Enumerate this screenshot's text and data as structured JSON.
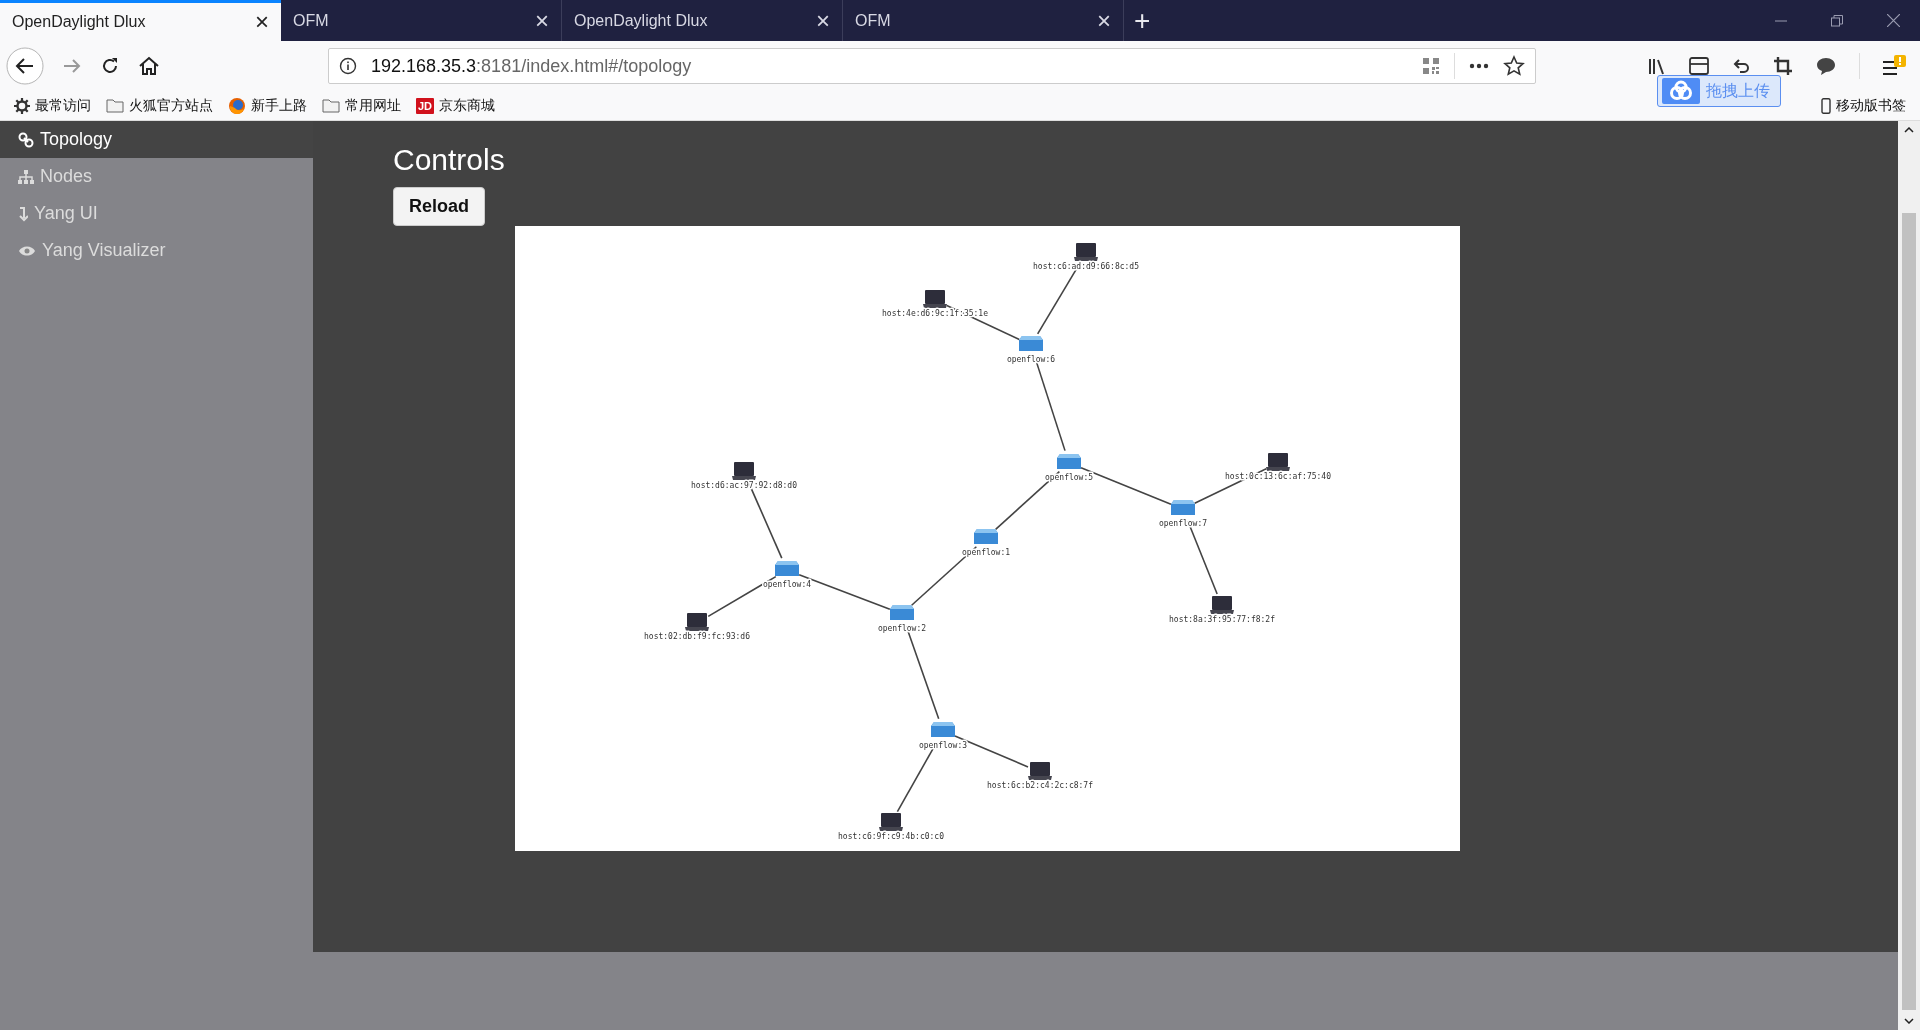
{
  "tabs": [
    {
      "title": "OpenDaylight Dlux",
      "selected": true,
      "close": "×"
    },
    {
      "title": "OFM",
      "selected": false,
      "close": "×"
    },
    {
      "title": "OpenDaylight Dlux",
      "selected": false,
      "close": "×"
    },
    {
      "title": "OFM",
      "selected": false,
      "close": "×"
    }
  ],
  "new_tab": "+",
  "address_bar": {
    "host": "192.168.35.3",
    "rest": ":8181/index.html#/topology"
  },
  "upload_popup": "拖拽上传",
  "bookmarks": [
    {
      "kind": "gear",
      "label": "最常访问"
    },
    {
      "kind": "folder",
      "label": "火狐官方站点"
    },
    {
      "kind": "globe",
      "label": "新手上路"
    },
    {
      "kind": "folder",
      "label": "常用网址"
    },
    {
      "kind": "jd",
      "label": "京东商城",
      "badge": "JD"
    }
  ],
  "mobile_bookmarks": "移动版书签",
  "sidebar": {
    "items": [
      {
        "kind": "link",
        "label": "Topology",
        "selected": true
      },
      {
        "kind": "sitemap",
        "label": "Nodes",
        "selected": false
      },
      {
        "kind": "arrow",
        "label": "Yang UI",
        "selected": false
      },
      {
        "kind": "eye",
        "label": "Yang Visualizer",
        "selected": false
      }
    ]
  },
  "controls": {
    "title": "Controls",
    "reload": "Reload"
  },
  "topology": {
    "nodes": [
      {
        "kind": "host",
        "label": "host:c6:ad:d9:66:8c:d5"
      },
      {
        "kind": "host",
        "label": "host:4e:d6:9c:1f:35:1e"
      },
      {
        "kind": "switch",
        "label": "openflow:6"
      },
      {
        "kind": "switch",
        "label": "openflow:5"
      },
      {
        "kind": "host",
        "label": "host:0c:13:6c:af:75:40"
      },
      {
        "kind": "host",
        "label": "host:d6:ac:97:92:d8:d0"
      },
      {
        "kind": "switch",
        "label": "openflow:7"
      },
      {
        "kind": "switch",
        "label": "openflow:1"
      },
      {
        "kind": "switch",
        "label": "openflow:4"
      },
      {
        "kind": "host",
        "label": "host:8a:3f:95:77:f8:2f"
      },
      {
        "kind": "switch",
        "label": "openflow:2"
      },
      {
        "kind": "host",
        "label": "host:02:db:f9:fc:93:d6"
      },
      {
        "kind": "switch",
        "label": "openflow:3"
      },
      {
        "kind": "host",
        "label": "host:6c:b2:c4:2c:c8:7f"
      },
      {
        "kind": "host",
        "label": "host:c6:9f:c9:4b:c0:c0"
      }
    ]
  }
}
